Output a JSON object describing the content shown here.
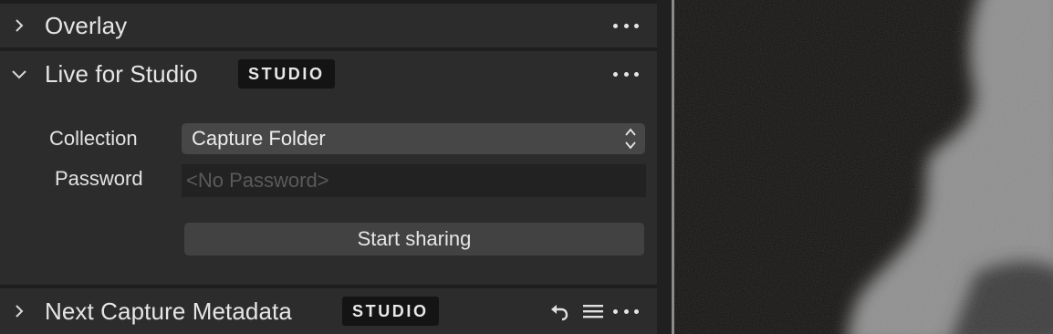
{
  "sections": {
    "overlay": {
      "title": "Overlay",
      "chevron": "chevron-right-icon",
      "menu_icon": "more-dots-icon"
    },
    "live": {
      "title": "Live for Studio",
      "badge": "STUDIO",
      "chevron": "chevron-down-icon",
      "menu_icon": "more-dots-icon",
      "collection_label": "Collection",
      "collection_value": "Capture Folder",
      "password_label": "Password",
      "password_placeholder": "<No Password>",
      "start_button": "Start sharing"
    },
    "next_capture": {
      "title": "Next Capture Metadata",
      "badge": "STUDIO",
      "chevron": "chevron-right-icon",
      "icons": [
        "reset-icon",
        "list-icon",
        "more-dots-icon"
      ]
    }
  },
  "colors": {
    "panel_bg": "#2c2c2c",
    "badge_bg": "#141414",
    "select_bg": "#474747",
    "input_bg": "#222222",
    "button_bg": "#424242"
  }
}
